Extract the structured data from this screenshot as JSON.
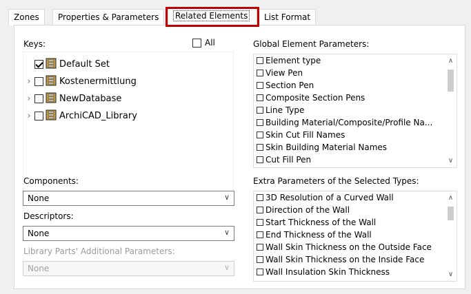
{
  "tabs": [
    {
      "label": "Zones"
    },
    {
      "label": "Properties & Parameters"
    },
    {
      "label": "Related Elements"
    },
    {
      "label": "List Format"
    }
  ],
  "keys": {
    "label": "Keys:",
    "all_label": "All",
    "items": [
      {
        "label": "Default Set",
        "checked": true
      },
      {
        "label": "Kostenermittlung",
        "checked": false
      },
      {
        "label": "NewDatabase",
        "checked": false
      },
      {
        "label": "ArchiCAD_Library",
        "checked": false
      }
    ]
  },
  "global": {
    "label": "Global Element Parameters:",
    "items": [
      "Element type",
      "View Pen",
      "Section Pen",
      "Composite Section Pens",
      "Line Type",
      "Building Material/Composite/Profile Na...",
      "Skin Cut Fill Names",
      "Skin Building Material Names",
      "Cut Fill Pen"
    ]
  },
  "components": {
    "label": "Components:",
    "value": "None"
  },
  "descriptors": {
    "label": "Descriptors:",
    "value": "None"
  },
  "library": {
    "label": "Library Parts' Additional Parameters:",
    "value": "None"
  },
  "extra": {
    "label": "Extra Parameters of the Selected Types:",
    "items": [
      "3D Resolution of a Curved Wall",
      "Direction of the Wall",
      "Start Thickness of the Wall",
      "End Thickness of the Wall",
      "Wall Skin Thickness on the Outside Face",
      "Wall Skin Thickness on the Inside Face",
      "Wall Insulation Skin Thickness"
    ]
  },
  "icons": {
    "scroll_up": "chevron-up-icon",
    "scroll_down": "chevron-down-icon",
    "expand": "chevron-right-icon",
    "database": "database-icon",
    "dropdown": "chevron-down-icon"
  },
  "colors": {
    "highlight": "#c00000",
    "database_icon": "#c8a24a"
  }
}
